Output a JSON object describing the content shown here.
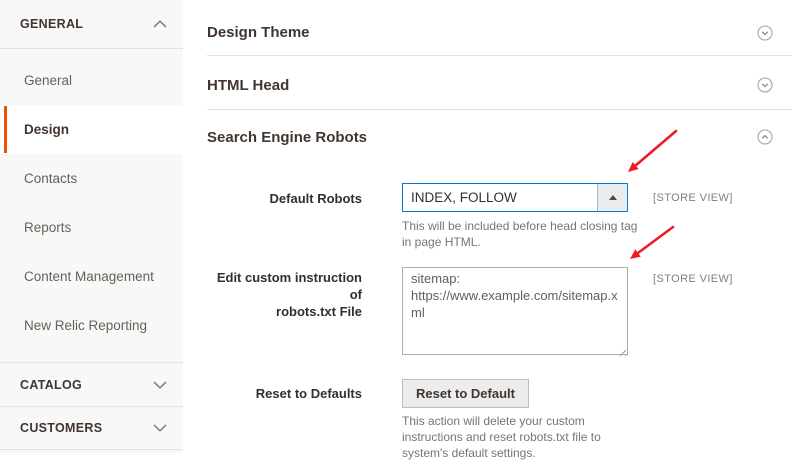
{
  "colors": {
    "accent_orange": "#eb5202",
    "focus_blue": "#007bdb",
    "arrow_red": "#ed1c24",
    "sidebar_bg": "#f8f8f8"
  },
  "sidebar": {
    "sections": [
      {
        "label": "GENERAL",
        "state": "expanded",
        "items": [
          {
            "label": "General",
            "active": false
          },
          {
            "label": "Design",
            "active": true
          },
          {
            "label": "Contacts",
            "active": false
          },
          {
            "label": "Reports",
            "active": false
          },
          {
            "label": "Content Management",
            "active": false
          },
          {
            "label": "New Relic Reporting",
            "active": false
          }
        ]
      },
      {
        "label": "CATALOG",
        "state": "collapsed"
      },
      {
        "label": "CUSTOMERS",
        "state": "collapsed"
      }
    ]
  },
  "main": {
    "sections": [
      {
        "title": "Design Theme",
        "state": "collapsed"
      },
      {
        "title": "HTML Head",
        "state": "collapsed"
      },
      {
        "title": "Search Engine Robots",
        "state": "expanded"
      }
    ],
    "form": {
      "default_robots": {
        "label": "Default Robots",
        "value": "INDEX, FOLLOW",
        "scope": "[STORE VIEW]",
        "note": "This will be included before head closing tag\nin page HTML."
      },
      "robots_txt": {
        "label": "Edit custom instruction of\nrobots.txt File",
        "value": "sitemap:\nhttps://www.example.com/sitemap.xml",
        "scope": "[STORE VIEW]"
      },
      "reset": {
        "label": "Reset to Defaults",
        "button_label": "Reset to Default",
        "note": "This action will delete your custom\ninstructions and reset robots.txt file to\nsystem's default settings."
      }
    }
  }
}
